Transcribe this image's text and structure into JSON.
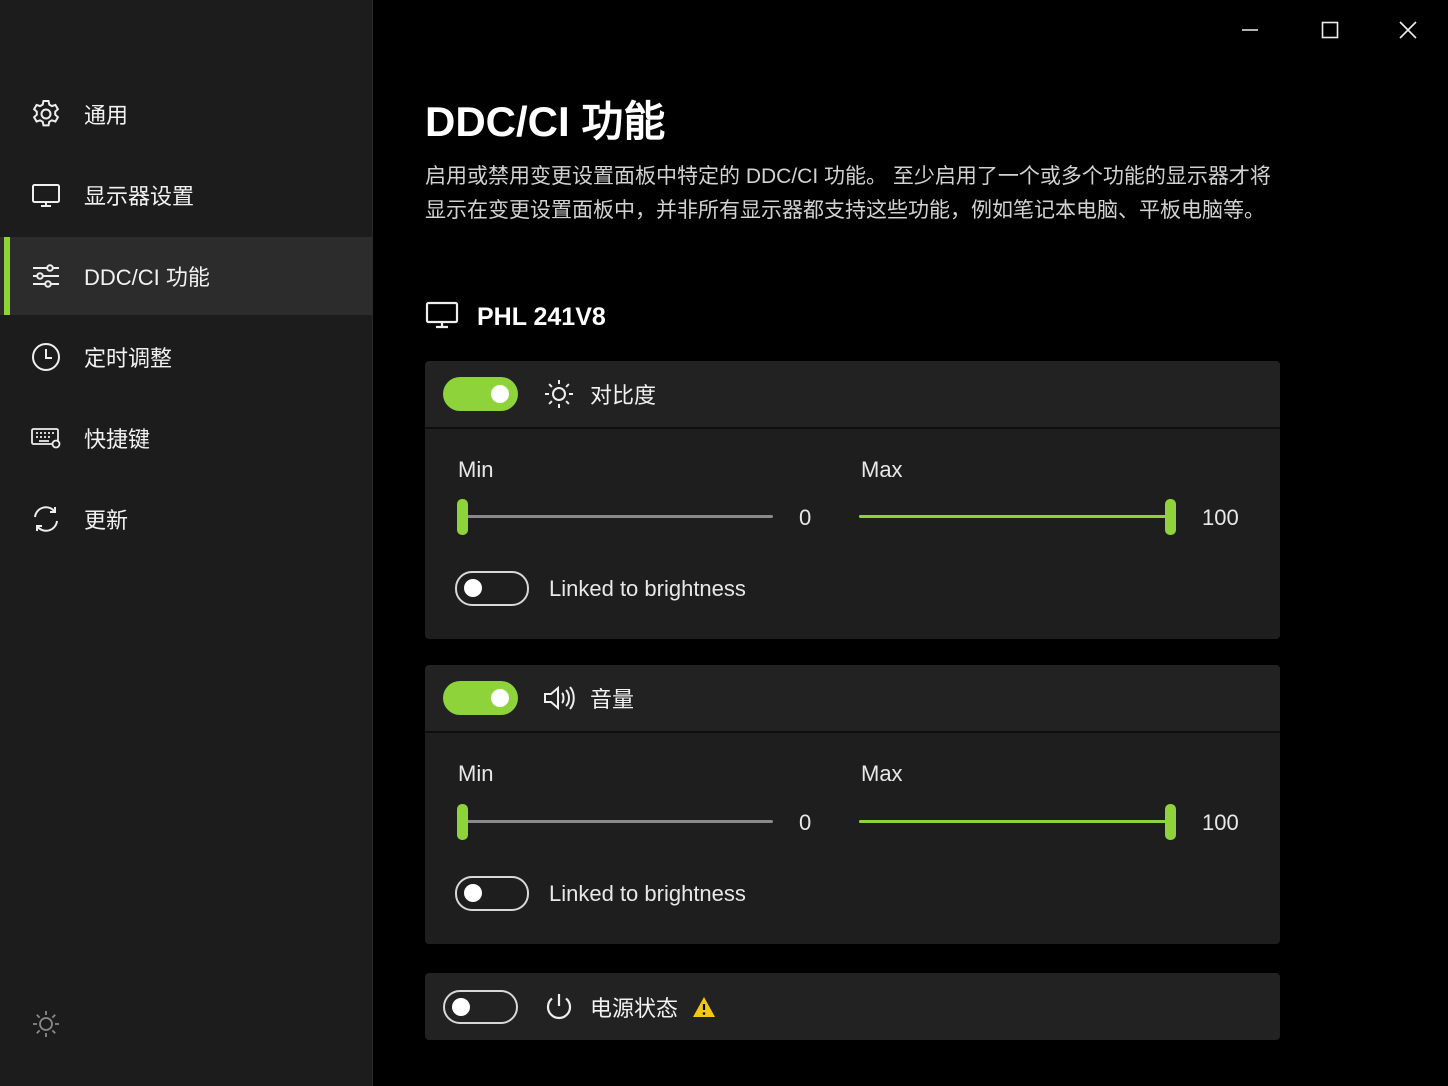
{
  "window": {
    "minimize": "minimize",
    "maximize": "maximize",
    "close": "close"
  },
  "sidebar": {
    "items": [
      {
        "label": "通用",
        "icon": "gear-icon"
      },
      {
        "label": "显示器设置",
        "icon": "monitor-icon"
      },
      {
        "label": "DDC/CI 功能",
        "icon": "sliders-icon",
        "active": true
      },
      {
        "label": "定时调整",
        "icon": "clock-icon"
      },
      {
        "label": "快捷键",
        "icon": "keyboard-icon"
      },
      {
        "label": "更新",
        "icon": "refresh-icon"
      }
    ],
    "theme_icon": "sun-icon"
  },
  "main": {
    "title": "DDC/CI 功能",
    "description": "启用或禁用变更设置面板中特定的 DDC/CI 功能。 至少启用了一个或多个功能的显示器才将显示在变更设置面板中，并非所有显示器都支持这些功能，例如笔记本电脑、平板电脑等。",
    "monitor": {
      "name": "PHL 241V8",
      "icon": "monitor-icon"
    },
    "features": [
      {
        "label": "对比度",
        "icon": "sun-icon",
        "enabled": true,
        "min_label": "Min",
        "max_label": "Max",
        "min_value": "0",
        "max_value": "100",
        "min_fraction": 0.0,
        "max_fraction": 1.0,
        "linked_label": "Linked to brightness",
        "linked": false
      },
      {
        "label": "音量",
        "icon": "speaker-icon",
        "enabled": true,
        "min_label": "Min",
        "max_label": "Max",
        "min_value": "0",
        "max_value": "100",
        "min_fraction": 0.0,
        "max_fraction": 1.0,
        "linked_label": "Linked to brightness",
        "linked": false
      },
      {
        "label": "电源状态",
        "icon": "power-icon",
        "enabled": false,
        "warning_icon": "warning-icon"
      }
    ]
  },
  "colors": {
    "accent": "#8fd33a",
    "sidebar_bg": "#1c1c1c",
    "card_bg": "#1e1e1e",
    "warning": "#f2c811"
  }
}
